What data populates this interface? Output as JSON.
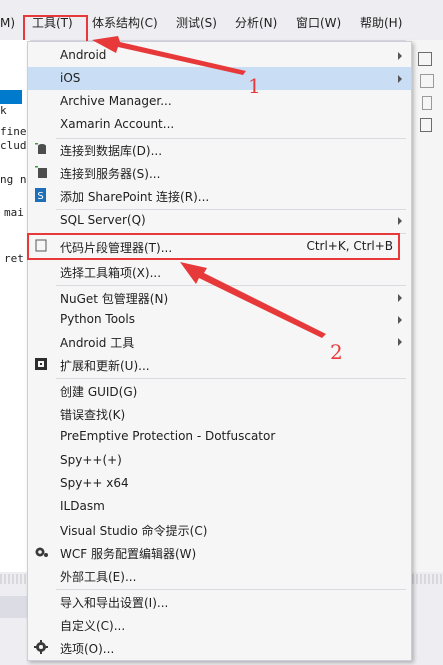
{
  "menubar": {
    "items": [
      {
        "label": "M)"
      },
      {
        "label": "工具(T)"
      },
      {
        "label": "体系结构(C)"
      },
      {
        "label": "测试(S)"
      },
      {
        "label": "分析(N)"
      },
      {
        "label": "窗口(W)"
      },
      {
        "label": "帮助(H)"
      }
    ]
  },
  "editor": {
    "lines": [
      "k",
      "fine",
      "clud",
      "ng n",
      "mai",
      "ret"
    ]
  },
  "menu": {
    "items": [
      {
        "label": "Android",
        "submenu": true
      },
      {
        "label": "iOS",
        "submenu": true,
        "selected": true
      },
      {
        "label": "Archive Manager..."
      },
      {
        "label": "Xamarin Account..."
      },
      {
        "label": "连接到数据库(D)...",
        "icon": "database-connect-icon"
      },
      {
        "label": "连接到服务器(S)...",
        "icon": "server-connect-icon"
      },
      {
        "label": "添加 SharePoint 连接(R)...",
        "icon": "sharepoint-icon"
      },
      {
        "label": "SQL Server(Q)",
        "submenu": true
      },
      {
        "label": "代码片段管理器(T)...",
        "shortcut": "Ctrl+K, Ctrl+B",
        "icon": "checkbox-icon"
      },
      {
        "label": "选择工具箱项(X)..."
      },
      {
        "label": "NuGet 包管理器(N)",
        "submenu": true
      },
      {
        "label": "Python Tools",
        "submenu": true
      },
      {
        "label": "Android 工具",
        "submenu": true
      },
      {
        "label": "扩展和更新(U)...",
        "icon": "extensions-icon"
      },
      {
        "label": "创建 GUID(G)"
      },
      {
        "label": "错误查找(K)"
      },
      {
        "label": "PreEmptive Protection - Dotfuscator"
      },
      {
        "label": "Spy++(+)"
      },
      {
        "label": "Spy++ x64"
      },
      {
        "label": "ILDasm"
      },
      {
        "label": "Visual Studio 命令提示(C)"
      },
      {
        "label": "WCF 服务配置编辑器(W)",
        "icon": "wcf-gear-icon"
      },
      {
        "label": "外部工具(E)..."
      },
      {
        "label": "导入和导出设置(I)..."
      },
      {
        "label": "自定义(C)..."
      },
      {
        "label": "选项(O)...",
        "icon": "options-gear-icon"
      }
    ]
  },
  "annotations": {
    "one": "1",
    "two": "2"
  },
  "colors": {
    "accent": "#007acc",
    "highlight": "#e8393a",
    "selected": "#c9def5"
  }
}
